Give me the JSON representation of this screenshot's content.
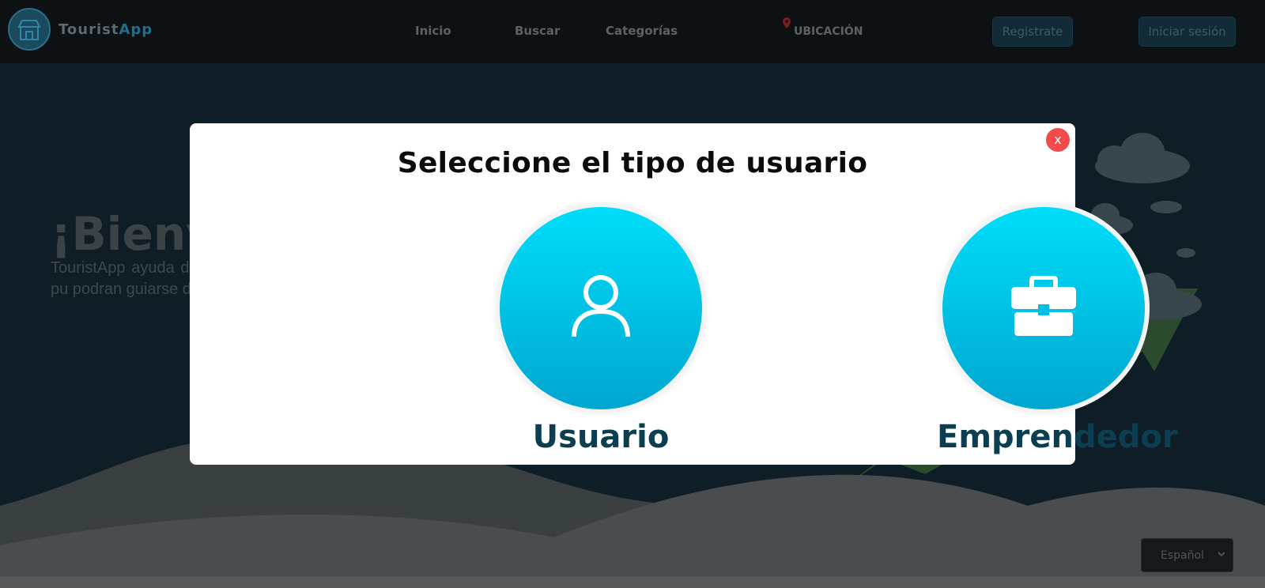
{
  "header": {
    "logo_text_1": "Tourist",
    "logo_text_2": "App",
    "nav": [
      "Inicio",
      "Buscar",
      "Categorías"
    ],
    "location_label": "UBICACIÓN",
    "register_label": "Registrate",
    "login_label": "Iniciar sesión"
  },
  "hero": {
    "title": "¡Bienv",
    "text": "TouristApp ayuda de una ciudad, pu podran guiarse de"
  },
  "language": {
    "selected": "Español"
  },
  "modal": {
    "title": "Seleccione el tipo de usuario",
    "close_label": "x",
    "options": [
      {
        "label": "Usuario",
        "icon": "user-icon"
      },
      {
        "label": "Emprendedor",
        "icon": "briefcase-icon"
      }
    ]
  },
  "colors": {
    "accent_cyan": "#00def9",
    "accent_dark": "#0b3e50",
    "close_red": "#f24b4b"
  }
}
